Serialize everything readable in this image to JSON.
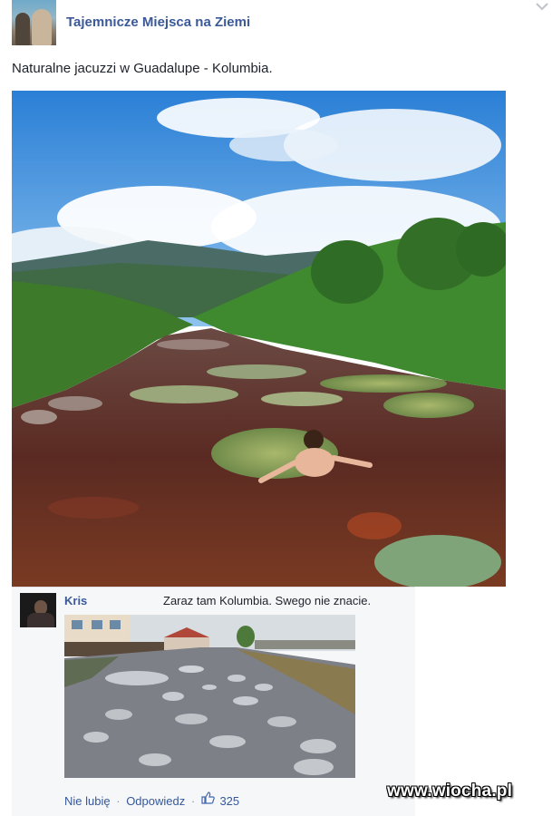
{
  "post": {
    "page_name": "Tajemnicze Miejsca na Ziemi",
    "text": "Naturalne jacuzzi w Guadalupe - Kolumbia.",
    "menu_icon": "chevron-down-icon"
  },
  "comment": {
    "author": "Kris",
    "text": "Zaraz tam Kolumbia. Swego nie znacie.",
    "actions": {
      "unlike": "Nie lubię",
      "separator": "·",
      "reply": "Odpowiedz",
      "like_icon": "thumbs-up-icon",
      "like_count": "325"
    }
  },
  "watermark": "www.wiocha.pl",
  "colors": {
    "link_blue": "#3b5998",
    "text_dark": "#1d2129",
    "comment_bg": "#f6f7f9"
  }
}
